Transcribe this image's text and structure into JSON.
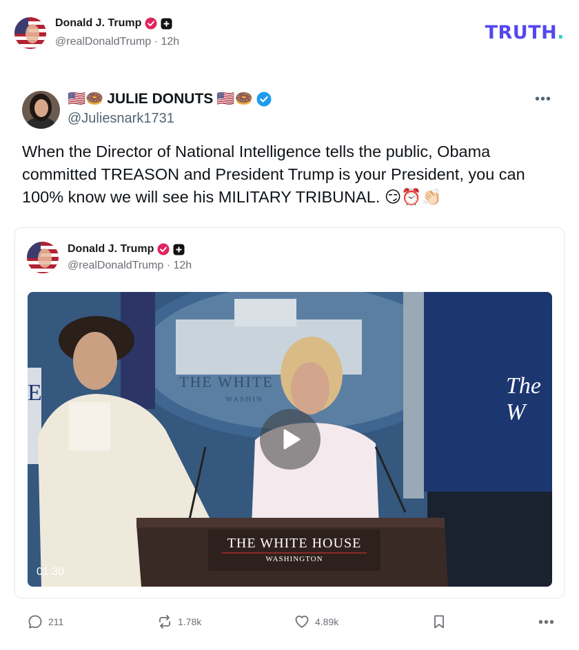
{
  "post": {
    "author_name": "Donald J. Trump",
    "author_handle": "@realDonaldTrump",
    "time": "12h",
    "separator": "·",
    "brand_logo": "TRUTH",
    "brand_logo_dot": "."
  },
  "quoted_tweet": {
    "name_prefix_emoji": "🇺🇸🍩",
    "name": "JULIE DONUTS",
    "name_suffix_emoji": "🇺🇸🍩",
    "handle": "@Juliesnark1731",
    "more_label": "•••",
    "text": "When the Director of National Intelligence tells the public, Obama committed TREASON and President Trump is your President, you can 100% know we will see his MILITARY TRIBUNAL. 😏⏰👏🏻"
  },
  "embedded_post": {
    "author_name": "Donald J. Trump",
    "author_handle": "@realDonaldTrump",
    "time": "12h",
    "separator": "·",
    "video": {
      "duration": "01:30",
      "podium_title": "THE WHITE HOUSE",
      "podium_subtitle": "WASHINGTON",
      "backdrop_text": "THE WHITE",
      "backdrop_sub": "WASHIN",
      "screen_text": "The W",
      "left_letter": "E"
    }
  },
  "actions": {
    "replies": "211",
    "retruths": "1.78k",
    "likes": "4.89k",
    "more_label": "•••"
  },
  "colors": {
    "brand": "#5448ee",
    "brand_dot": "#2ed3c6",
    "verified_pink": "#e0245e",
    "verified_blue": "#1d9bf0",
    "muted": "#6b6f76"
  },
  "icons": [
    "verified-badge-icon",
    "plus-badge-icon",
    "more-icon",
    "play-icon",
    "reply-icon",
    "retruth-icon",
    "like-icon",
    "bookmark-icon"
  ]
}
